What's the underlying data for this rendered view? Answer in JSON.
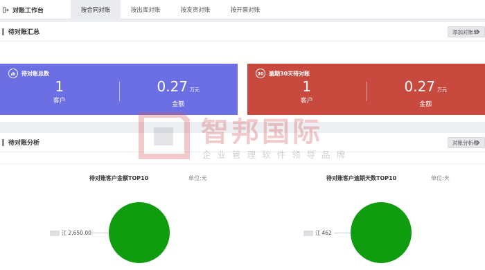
{
  "topbar": {
    "title": "对账工作台",
    "tabs": [
      {
        "label": "按合同对账",
        "active": true
      },
      {
        "label": "按出库对账",
        "active": false
      },
      {
        "label": "按发货对账",
        "active": false
      },
      {
        "label": "按开票对账",
        "active": false
      }
    ]
  },
  "summary": {
    "title": "待对账汇总",
    "add_button": "添加对账单",
    "cards": [
      {
        "title": "待对账总数",
        "icon": "bar-chart-icon",
        "color": "#6b6fe3",
        "left_value": "1",
        "left_label": "客户",
        "right_value": "0.27",
        "right_unit": "万元",
        "right_label": "金额"
      },
      {
        "title": "逾期30天待对账",
        "icon": "30-days-icon",
        "color": "#c8493d",
        "left_value": "1",
        "left_label": "客户",
        "right_value": "0.27",
        "right_unit": "万元",
        "right_label": "金额"
      }
    ]
  },
  "analysis": {
    "title": "待对账分析",
    "button": "对账分析看",
    "charts": [
      {
        "title": "待对账客户金额TOP10",
        "unit": "单位:元",
        "label_value": "2,650.00",
        "label_prefix": "江"
      },
      {
        "title": "待对账客户逾期天数TOP10",
        "unit": "单位:天",
        "label_value": "462",
        "label_prefix": "江"
      }
    ]
  },
  "watermark": {
    "name": "智邦国际",
    "sub": "企业管理软件领导品牌"
  },
  "chart_data": [
    {
      "type": "pie",
      "title": "待对账客户金额TOP10",
      "unit": "单位:元",
      "series": [
        {
          "values": [
            2650.0
          ]
        }
      ],
      "color": "#0f9c0f"
    },
    {
      "type": "pie",
      "title": "待对账客户逾期天数TOP10",
      "unit": "单位:天",
      "series": [
        {
          "values": [
            462
          ]
        }
      ],
      "color": "#0f9c0f"
    }
  ]
}
